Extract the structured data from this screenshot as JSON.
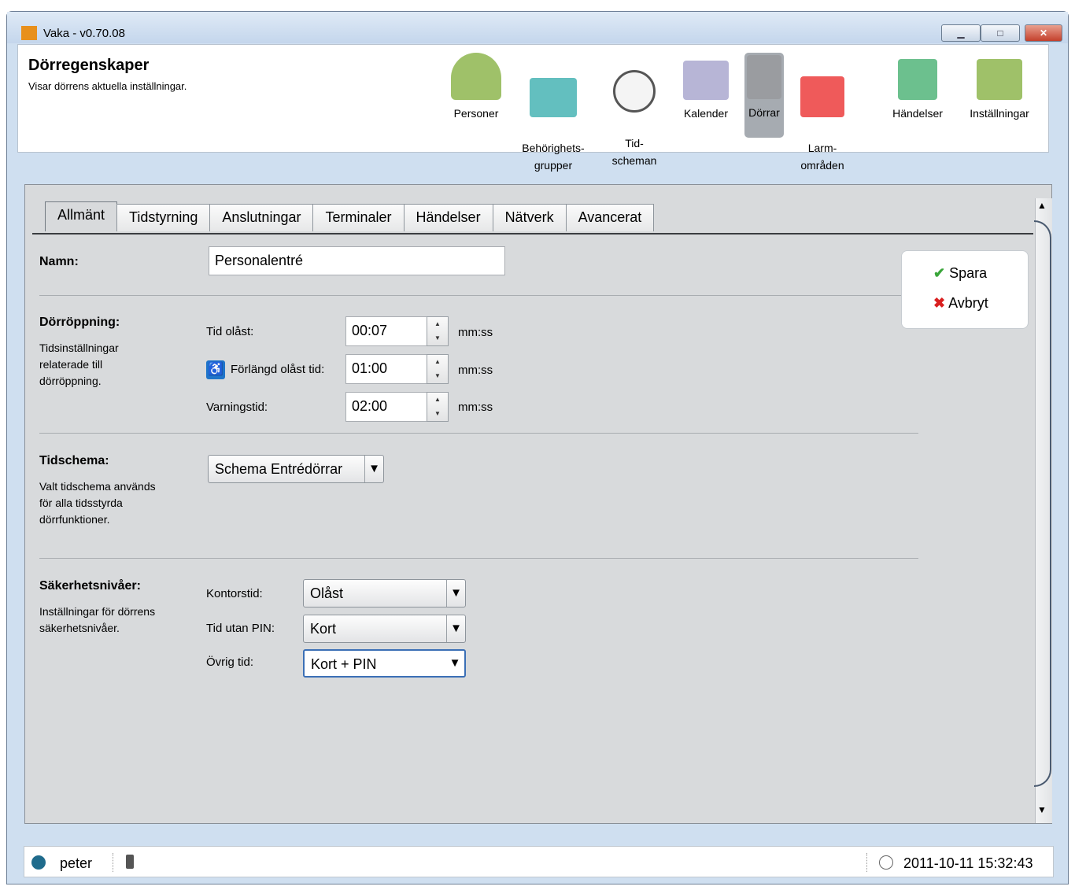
{
  "window": {
    "title": "Vaka - v0.70.08",
    "minimize": "▁",
    "maximize": "□",
    "close": "✕"
  },
  "header": {
    "title": "Dörregenskaper",
    "subtitle": "Visar dörrens aktuella inställningar."
  },
  "nav": [
    {
      "label": "Personer",
      "icon": "persons-icon",
      "color": "#9fc169"
    },
    {
      "label": "Behörighets-\ngrupper",
      "icon": "id-card-icon",
      "color": "#63bfbf"
    },
    {
      "label": "Tid-\nscheman",
      "icon": "clock-icon",
      "color": "#d9dadc"
    },
    {
      "label": "Kalender",
      "icon": "calendar-icon",
      "color": "#b7b5d6"
    },
    {
      "label": "Dörrar",
      "icon": "door-icon",
      "color": "#9a9ca0"
    },
    {
      "label": "Larm-\nområden",
      "icon": "alarm-area-icon",
      "color": "#ef5a5a"
    },
    {
      "label": "Händelser",
      "icon": "events-icon",
      "color": "#6cc08e"
    },
    {
      "label": "Inställningar",
      "icon": "settings-sliders-icon",
      "color": "#9fc169"
    }
  ],
  "tabs": [
    "Allmänt",
    "Tidstyrning",
    "Anslutningar",
    "Terminaler",
    "Händelser",
    "Nätverk",
    "Avancerat"
  ],
  "form": {
    "name_label": "Namn:",
    "name_value": "Personalentré",
    "opening": {
      "title": "Dörröppning:",
      "desc": "Tidsinställningar\nrelaterade till\ndörröppning.",
      "unlock_label": "Tid olåst:",
      "unlock_value": "00:07",
      "extended_label": "Förlängd olåst tid:",
      "extended_value": "01:00",
      "warning_label": "Varningstid:",
      "warning_value": "02:00",
      "unit": "mm:ss"
    },
    "schedule": {
      "title": "Tidschema:",
      "desc": "Valt tidschema används\nför alla tidsstyrda\ndörrfunktioner.",
      "value": "Schema Entrédörrar"
    },
    "security": {
      "title": "Säkerhetsnivåer:",
      "desc": "Inställningar för dörrens\nsäkerhetsnivåer.",
      "office_label": "Kontorstid:",
      "office_value": "Olåst",
      "nopin_label": "Tid utan PIN:",
      "nopin_value": "Kort",
      "other_label": "Övrig tid:",
      "other_value": "Kort + PIN"
    }
  },
  "actions": {
    "save": "Spara",
    "cancel": "Avbryt"
  },
  "status": {
    "user": "peter",
    "datetime": "2011-10-11 15:32:43"
  },
  "colors": {
    "save": "#3aa53a",
    "cancel": "#d92020"
  }
}
